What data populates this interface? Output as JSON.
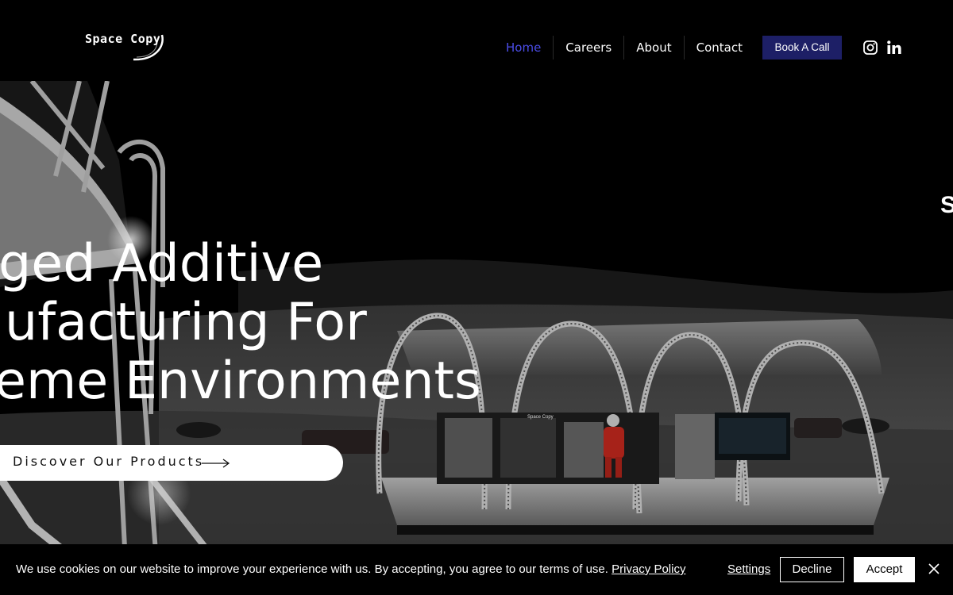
{
  "header": {
    "logo_text": "Space Copy",
    "nav": [
      {
        "label": "Home",
        "active": true
      },
      {
        "label": "Careers"
      },
      {
        "label": "About"
      },
      {
        "label": "Contact"
      }
    ],
    "cta_label": "Book A Call",
    "social_icons": [
      "instagram-icon",
      "linkedin-icon"
    ],
    "accent_color": "#4b4de8",
    "cta_color": "#1d1f66"
  },
  "hero": {
    "headline_lines": [
      "ged Additive",
      "ufacturing For",
      "eme Environments"
    ],
    "side_letter": "S",
    "cta_label": "Discover Our Products",
    "cta_icon": "arrow-right-icon",
    "image_text": "Space Copy"
  },
  "cookie_banner": {
    "message": "We use cookies on our website to improve your experience with us. By accepting, you agree to our terms of use.",
    "link_label": "Privacy Policy",
    "settings_label": "Settings",
    "decline_label": "Decline",
    "accept_label": "Accept",
    "close_icon": "close-icon"
  }
}
